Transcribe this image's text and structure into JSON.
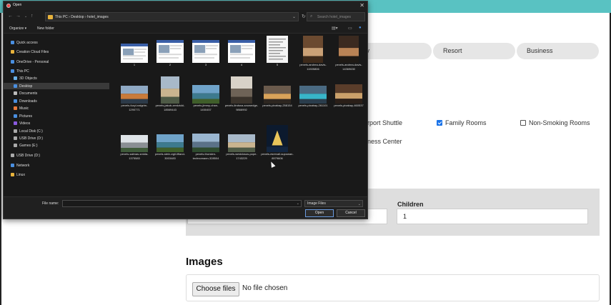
{
  "page": {
    "pills": [
      "xury",
      "Resort",
      "Business"
    ],
    "amenities": [
      {
        "label": "rport Shuttle",
        "checked": null
      },
      {
        "label": "Family Rooms",
        "checked": true
      },
      {
        "label": "Non-Smoking Rooms",
        "checked": false
      },
      {
        "label": "ness Center",
        "checked": null
      }
    ],
    "children_label": "Children",
    "children_value": "1",
    "images_heading": "Images",
    "choose_files_label": "Choose files",
    "no_file_text": "No file chosen",
    "colors": {
      "topbar": "#59c2c2",
      "checkbox_checked": "#1a73e8"
    }
  },
  "dialog": {
    "title": "Open",
    "breadcrumb": "This PC  ›  Desktop  ›  hotel_images",
    "search_placeholder": "Search hotel_images",
    "organize_label": "Organize ▾",
    "new_folder_label": "New folder",
    "sidebar": [
      {
        "label": "Quick access",
        "icon": "star-icon",
        "selected": false
      },
      {
        "label": "Creation Cloud Files",
        "icon": "cloud-folder-icon",
        "selected": false
      },
      {
        "label": "OneDrive - Personal",
        "icon": "onedrive-icon",
        "selected": false
      },
      {
        "label": "This PC",
        "icon": "computer-icon",
        "selected": false
      },
      {
        "label": "3D Objects",
        "icon": "cube-icon",
        "selected": false
      },
      {
        "label": "Desktop",
        "icon": "desktop-icon",
        "selected": true
      },
      {
        "label": "Documents",
        "icon": "documents-icon",
        "selected": false
      },
      {
        "label": "Downloads",
        "icon": "downloads-icon",
        "selected": false
      },
      {
        "label": "Music",
        "icon": "music-icon",
        "selected": false
      },
      {
        "label": "Pictures",
        "icon": "pictures-icon",
        "selected": false
      },
      {
        "label": "Videos",
        "icon": "videos-icon",
        "selected": false
      },
      {
        "label": "Local Disk (C:)",
        "icon": "drive-icon",
        "selected": false
      },
      {
        "label": "USB Drive (D:)",
        "icon": "usb-icon",
        "selected": false
      },
      {
        "label": "Games (E:)",
        "icon": "drive-icon",
        "selected": false
      },
      {
        "label": "USB Drive (D:)",
        "icon": "usb-icon",
        "selected": false
      },
      {
        "label": "Network",
        "icon": "network-icon",
        "selected": false
      },
      {
        "label": "Linux",
        "icon": "linux-icon",
        "selected": false
      }
    ],
    "files": [
      {
        "name": "1",
        "kind": "screenshot"
      },
      {
        "name": "2",
        "kind": "screenshot"
      },
      {
        "name": "3",
        "kind": "screenshot"
      },
      {
        "name": "4",
        "kind": "screenshot"
      },
      {
        "name": "5",
        "kind": "document"
      },
      {
        "name": "pexels-andrea-davis-11505806",
        "kind": "photo-room"
      },
      {
        "name": "pexels-andrea-davis-14369630",
        "kind": "photo-portrait"
      },
      {
        "name": "pexels-fuzyl-nalgrim-1290771",
        "kind": "photo-city"
      },
      {
        "name": "pexels-jakub-zerdzicki-18569443",
        "kind": "photo-building"
      },
      {
        "name": "pexels-jimmy-chan-1450457",
        "kind": "photo-lake"
      },
      {
        "name": "pexels-lindsna-snowedge-9866992",
        "kind": "photo-hall"
      },
      {
        "name": "pexels-pixabay-258154",
        "kind": "photo-resort"
      },
      {
        "name": "pexels-pixabay-261101",
        "kind": "photo-pool"
      },
      {
        "name": "pexels-pixabay-460537",
        "kind": "photo-interior"
      },
      {
        "name": "pexels-salmas-smida-1375583",
        "kind": "photo-hotel"
      },
      {
        "name": "pexels-stein-egil-lifland-3003483",
        "kind": "photo-lake"
      },
      {
        "name": "pexels-thorsten-technomann-328504",
        "kind": "photo-mountain"
      },
      {
        "name": "pexels-westdosos-pope-1743229",
        "kind": "photo-building"
      },
      {
        "name": "pexels-esrevail-supowan-8979606",
        "kind": "photo-night"
      }
    ],
    "file_name_label": "File name:",
    "file_name_value": "",
    "file_type_value": "Image Files",
    "open_label": "Open",
    "cancel_label": "Cancel"
  }
}
